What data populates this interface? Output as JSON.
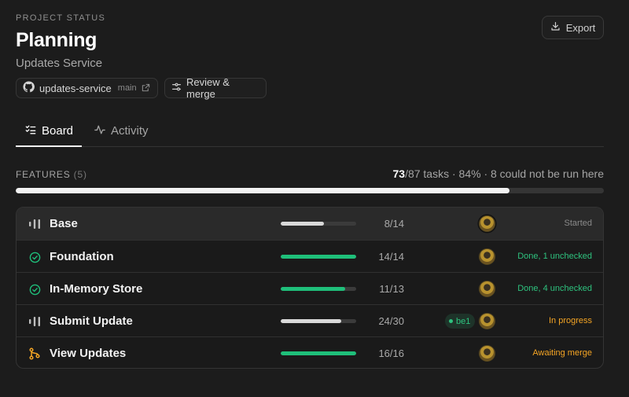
{
  "header": {
    "eyebrow": "PROJECT STATUS",
    "title": "Planning",
    "subtitle": "Updates Service",
    "export_label": "Export"
  },
  "repo": {
    "name": "updates-service",
    "branch": "main",
    "review_label": "Review & merge"
  },
  "tabs": [
    {
      "label": "Board",
      "icon": "checklist-icon",
      "active": true
    },
    {
      "label": "Activity",
      "icon": "activity-icon",
      "active": false
    }
  ],
  "features": {
    "label": "FEATURES",
    "count": "(5)",
    "tasks_done": "73",
    "tasks_rest": "/87 tasks · 84% · 8 could not be run here",
    "progress": 0.84
  },
  "rows": [
    {
      "name": "Base",
      "icon": "bars-icon",
      "progress": 0.57,
      "bar_color": "#d9d9d9",
      "count": "8/14",
      "branch": "",
      "status": "Started",
      "status_color": "#8a8a8a"
    },
    {
      "name": "Foundation",
      "icon": "check-circle-icon",
      "progress": 1.0,
      "bar_color": "#1fbf7a",
      "count": "14/14",
      "branch": "",
      "status": "Done, 1 unchecked",
      "status_color": "#2ec27e"
    },
    {
      "name": "In-Memory Store",
      "icon": "check-circle-icon",
      "progress": 0.85,
      "bar_color": "#1fbf7a",
      "count": "11/13",
      "branch": "",
      "status": "Done, 4 unchecked",
      "status_color": "#2ec27e"
    },
    {
      "name": "Submit Update",
      "icon": "bars-icon",
      "progress": 0.8,
      "bar_color": "#d9d9d9",
      "count": "24/30",
      "branch": "be1",
      "status": "In progress",
      "status_color": "#f5a524"
    },
    {
      "name": "View Updates",
      "icon": "merge-icon",
      "progress": 1.0,
      "bar_color": "#1fbf7a",
      "count": "16/16",
      "branch": "",
      "status": "Awaiting merge",
      "status_color": "#f5a524"
    }
  ]
}
